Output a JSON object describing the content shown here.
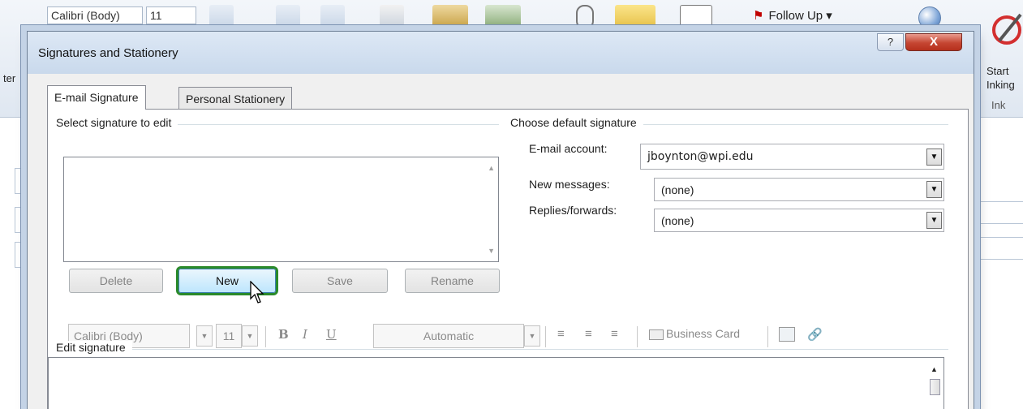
{
  "ribbon": {
    "font_name": "Calibri (Body)",
    "font_size": "11",
    "follow_up": "Follow Up",
    "start_inking": "Start\nInking",
    "ink_group": "Ink",
    "partial_left": "ter"
  },
  "dialog": {
    "title": "Signatures and Stationery",
    "help": "?",
    "close": "X"
  },
  "tabs": [
    {
      "label": "E-mail Signature",
      "selected": true
    },
    {
      "label": "Personal Stationery",
      "selected": false
    }
  ],
  "select_section": {
    "label": "Select signature to edit",
    "items": []
  },
  "buttons": {
    "delete": "Delete",
    "new": "New",
    "save": "Save",
    "rename": "Rename"
  },
  "defaults": {
    "label": "Choose default signature",
    "email_account_label": "E-mail account:",
    "email_account_value": "jboynton@wpi.edu",
    "new_messages_label": "New messages:",
    "new_messages_value": "(none)",
    "replies_label": "Replies/forwards:",
    "replies_value": "(none)"
  },
  "edit_section": {
    "label": "Edit signature",
    "font": "Calibri (Body)",
    "size": "11",
    "bold": "B",
    "italic": "I",
    "underline": "U",
    "color": "Automatic",
    "business_card": "Business Card",
    "content": ""
  },
  "colors": {
    "new_button_highlight": "#2a8a2a",
    "close_button": "#c54532",
    "follow_up_flag": "#c00000"
  }
}
